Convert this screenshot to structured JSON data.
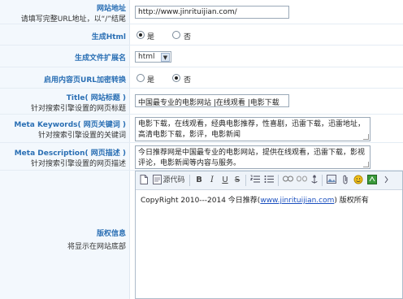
{
  "site_url": {
    "label": "网站地址",
    "hint": "请填写完整URL地址，以“/”结尾",
    "value": "http://www.jinrituijian.com/"
  },
  "generate_html": {
    "label": "生成Html",
    "yes": "是",
    "no": "否",
    "selected": "yes"
  },
  "file_ext": {
    "label": "生成文件扩展名",
    "value": "html"
  },
  "url_encrypt": {
    "label": "启用内容页URL加密转换",
    "yes": "是",
    "no": "否",
    "selected": "no"
  },
  "title": {
    "label": "Title( 网站标题 )",
    "hint": "针对搜索引擎设置的网页标题",
    "value": "中国最专业的电影网站 |在线观看 |电影下载"
  },
  "keywords": {
    "label": "Meta Keywords( 网页关键词 )",
    "hint": "针对搜索引擎设置的关键词",
    "value_line1": "电影下载，在线观看，经典电影推荐，性喜剧，迅雷下载，迅雷地址，",
    "value_line2": "高清电影下载，影评，电影新闻"
  },
  "description": {
    "label": "Meta Description( 网页描述 )",
    "hint": "针对搜索引擎设置的网页描述",
    "value_line1": "今日推荐网是中国最专业的电影网站，提供在线观看，迅雷下载，影视",
    "value_line2": "评论，电影新闻等内容与服务。"
  },
  "copyright": {
    "label": "版权信息",
    "hint": "将显示在网站底部",
    "toolbar": {
      "source_label": "源代码",
      "bold": "B",
      "italic": "I",
      "underline": "U",
      "strike": "S"
    },
    "content_prefix": "CopyRight 2010---2014 今日推荐(",
    "content_link": "www.jinrituijian.com",
    "content_suffix": ") 版权所有"
  },
  "colors": {
    "label_text": "#2a6fb4",
    "label_bg": "#f3f8fd",
    "link": "#1a4fbf"
  }
}
